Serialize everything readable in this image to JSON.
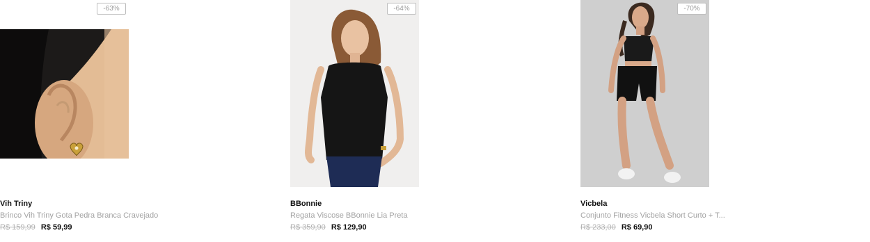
{
  "products": [
    {
      "discount": "-63%",
      "brand": "Vih Triny",
      "name": "Brinco Vih Triny Gota Pedra Branca Cravejado",
      "old_price": "R$ 159,99",
      "price": "R$ 59,99"
    },
    {
      "discount": "-64%",
      "brand": "BBonnie",
      "name": "Regata Viscose BBonnie Lia Preta",
      "old_price": "R$ 359,90",
      "price": "R$ 129,90"
    },
    {
      "discount": "-70%",
      "brand": "Vicbela",
      "name": "Conjunto Fitness Vicbela Short Curto + T...",
      "old_price": "R$ 233,00",
      "price": "R$ 69,90"
    }
  ]
}
